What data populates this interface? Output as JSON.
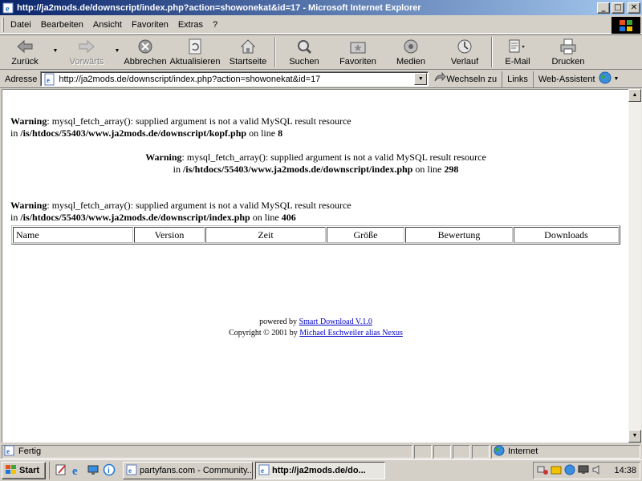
{
  "window": {
    "title": "http://ja2mods.de/downscript/index.php?action=showonekat&id=17 - Microsoft Internet Explorer",
    "minimize": "_",
    "maximize": "□",
    "close": "✕"
  },
  "menu": [
    "Datei",
    "Bearbeiten",
    "Ansicht",
    "Favoriten",
    "Extras",
    "?"
  ],
  "toolbar": {
    "back": "Zurück",
    "forward": "Vorwärts",
    "stop": "Abbrechen",
    "refresh": "Aktualisieren",
    "home": "Startseite",
    "search": "Suchen",
    "favorites": "Favoriten",
    "media": "Medien",
    "history": "Verlauf",
    "mail": "E-Mail",
    "print": "Drucken"
  },
  "address": {
    "label": "Adresse",
    "url": "http://ja2mods.de/downscript/index.php?action=showonekat&id=17",
    "go": "Wechseln zu",
    "links": "Links",
    "assistant": "Web-Assistent"
  },
  "page": {
    "warnings": [
      {
        "label": "Warning",
        "message": ": mysql_fetch_array(): supplied argument is not a valid MySQL result resource",
        "in": "in ",
        "path": "/is/htdocs/55403/www.ja2mods.de/downscript/kopf.php",
        "on_line": " on line ",
        "line": "8"
      },
      {
        "label": "Warning",
        "message": ": mysql_fetch_array(): supplied argument is not a valid MySQL result resource",
        "in": "in ",
        "path": "/is/htdocs/55403/www.ja2mods.de/downscript/index.php",
        "on_line": " on line ",
        "line": "298"
      },
      {
        "label": "Warning",
        "message": ": mysql_fetch_array(): supplied argument is not a valid MySQL result resource",
        "in": "in ",
        "path": "/is/htdocs/55403/www.ja2mods.de/downscript/index.php",
        "on_line": " on line ",
        "line": "406"
      }
    ],
    "table_headers": [
      "Name",
      "Version",
      "Zeit",
      "Größe",
      "Bewertung",
      "Downloads"
    ],
    "footer": {
      "powered_by": "powered by ",
      "product_link": "Smart Download V.1.0",
      "copyright": "Copyright © 2001 by ",
      "author_link": "Michael Eschweiler alias Nexus"
    }
  },
  "status": {
    "text": "Fertig",
    "zone": "Internet"
  },
  "taskbar": {
    "start": "Start",
    "tasks": [
      "partyfans.com - Community...",
      "http://ja2mods.de/do..."
    ],
    "clock": "14:38"
  }
}
